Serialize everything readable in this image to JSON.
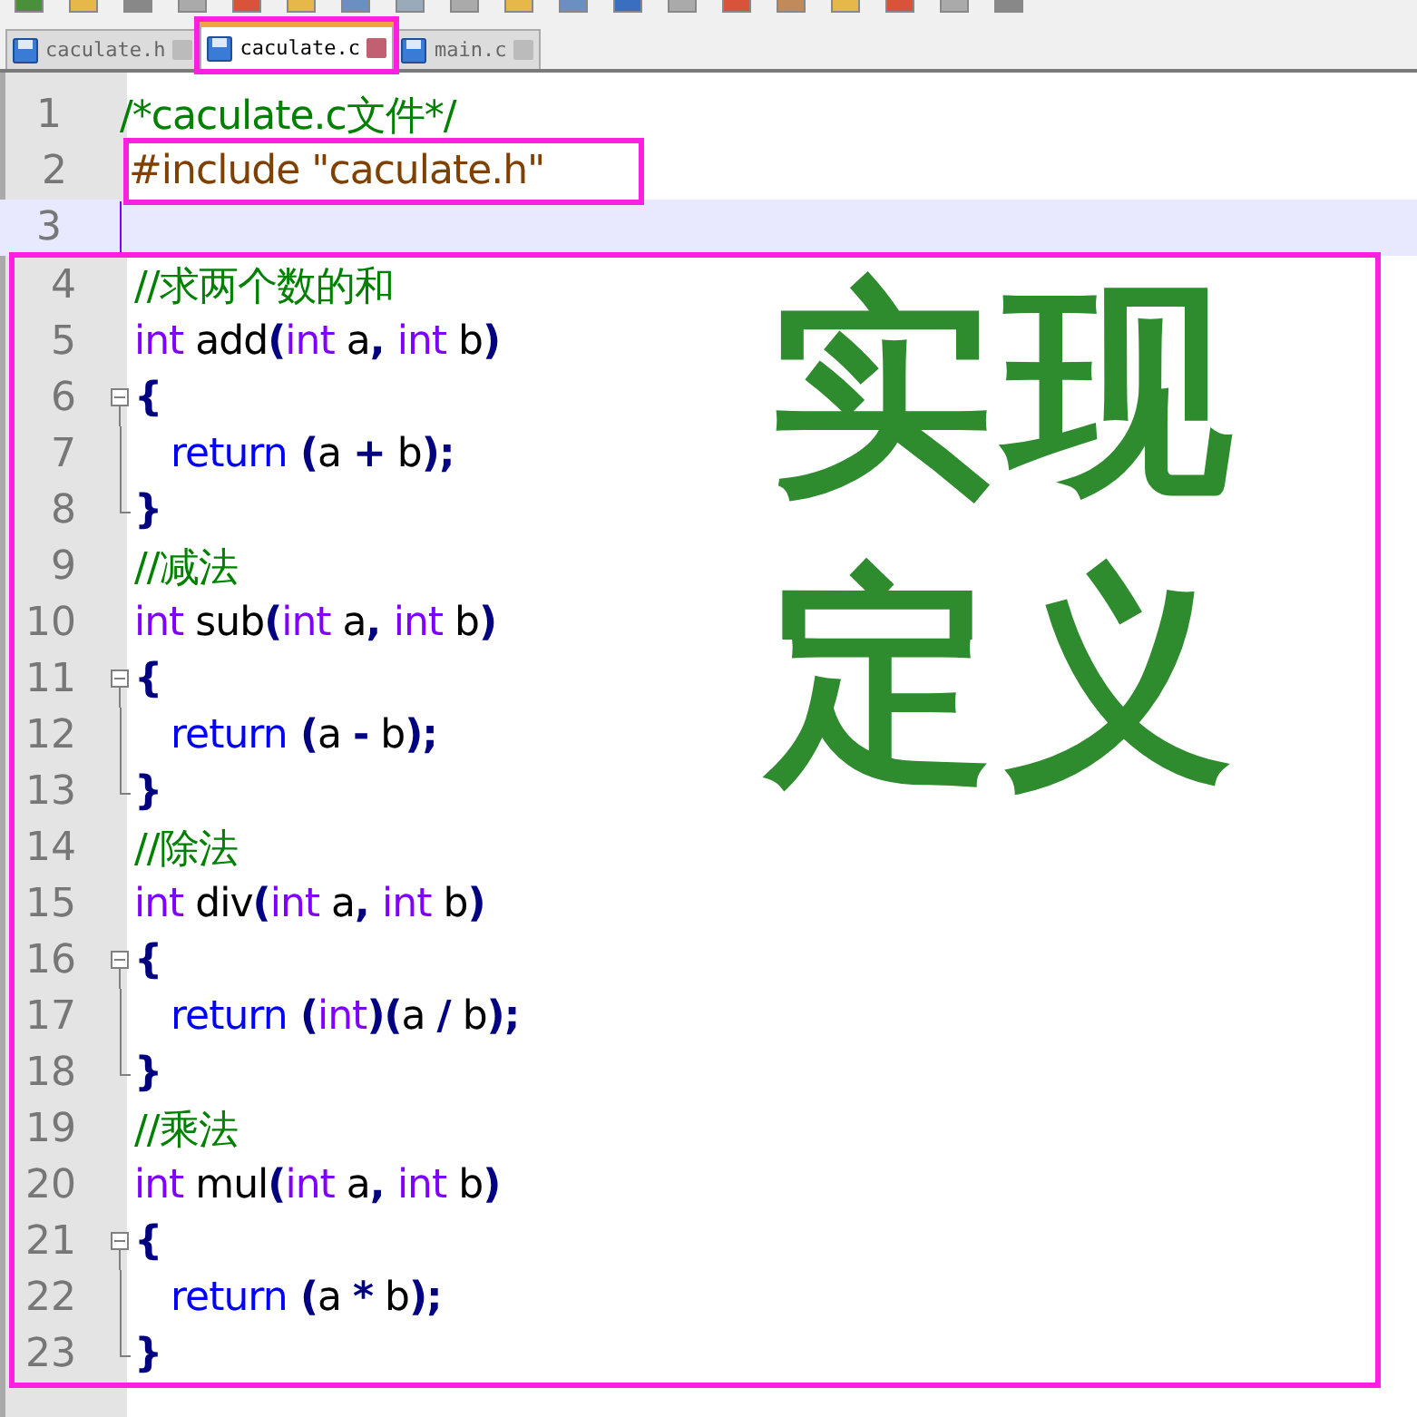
{
  "tabs": [
    {
      "label": "caculate.h",
      "selected": false,
      "outlined": false
    },
    {
      "label": "caculate.c",
      "selected": true,
      "outlined": true
    },
    {
      "label": "main.c",
      "selected": false,
      "outlined": false
    }
  ],
  "blocks": [
    {
      "kind": "plain",
      "lines": [
        {
          "number": "1",
          "kind": "plain",
          "current": false,
          "indent": false,
          "tokens": [
            {
              "kind": "comment",
              "text": "/*caculate.c文件*/"
            }
          ]
        }
      ]
    },
    {
      "kind": "code",
      "lines": [
        {
          "number": "2",
          "kind": "plain",
          "current": false,
          "indent": false,
          "tokens": [
            {
              "kind": "preproc",
              "text": "#include \"caculate.h\""
            }
          ]
        }
      ]
    },
    {
      "kind": "plain",
      "lines": [
        {
          "number": "3",
          "kind": "plain",
          "current": true
        }
      ]
    },
    {
      "kind": "full",
      "annotation": [
        "实现",
        "定义"
      ],
      "lines": [
        {
          "number": "4",
          "kind": "plain",
          "current": false,
          "indent": false,
          "tokens": [
            {
              "kind": "comment",
              "text": "//求两个数的和"
            }
          ]
        },
        {
          "number": "5",
          "kind": "plain",
          "current": false,
          "indent": false,
          "tokens": [
            {
              "kind": "type",
              "text": "int"
            },
            {
              "kind": "plain",
              "text": " add"
            },
            {
              "kind": "op",
              "text": "("
            },
            {
              "kind": "type",
              "text": "int"
            },
            {
              "kind": "plain",
              "text": " a"
            },
            {
              "kind": "op",
              "text": ", "
            },
            {
              "kind": "type",
              "text": "int"
            },
            {
              "kind": "plain",
              "text": " b"
            },
            {
              "kind": "op",
              "text": ")"
            }
          ]
        },
        {
          "number": "6",
          "kind": "open",
          "current": false,
          "indent": false,
          "tokens": [
            {
              "kind": "op",
              "text": "{"
            }
          ]
        },
        {
          "number": "7",
          "kind": "inner",
          "current": false,
          "indent": true,
          "tokens": [
            {
              "kind": "keyword",
              "text": "return"
            },
            {
              "kind": "op",
              "text": " ("
            },
            {
              "kind": "plain",
              "text": "a "
            },
            {
              "kind": "op",
              "text": "+"
            },
            {
              "kind": "plain",
              "text": " b"
            },
            {
              "kind": "op",
              "text": ");"
            }
          ]
        },
        {
          "number": "8",
          "kind": "close",
          "current": false,
          "indent": false,
          "tokens": [
            {
              "kind": "op",
              "text": "}"
            }
          ]
        },
        {
          "number": "9",
          "kind": "plain",
          "current": false,
          "indent": false,
          "tokens": [
            {
              "kind": "comment",
              "text": "//减法"
            }
          ]
        },
        {
          "number": "10",
          "kind": "plain",
          "current": false,
          "indent": false,
          "tokens": [
            {
              "kind": "type",
              "text": "int"
            },
            {
              "kind": "plain",
              "text": " sub"
            },
            {
              "kind": "op",
              "text": "("
            },
            {
              "kind": "type",
              "text": "int"
            },
            {
              "kind": "plain",
              "text": " a"
            },
            {
              "kind": "op",
              "text": ", "
            },
            {
              "kind": "type",
              "text": "int"
            },
            {
              "kind": "plain",
              "text": " b"
            },
            {
              "kind": "op",
              "text": ")"
            }
          ]
        },
        {
          "number": "11",
          "kind": "open",
          "current": false,
          "indent": false,
          "tokens": [
            {
              "kind": "op",
              "text": "{"
            }
          ]
        },
        {
          "number": "12",
          "kind": "inner",
          "current": false,
          "indent": true,
          "tokens": [
            {
              "kind": "keyword",
              "text": "return"
            },
            {
              "kind": "op",
              "text": " ("
            },
            {
              "kind": "plain",
              "text": "a "
            },
            {
              "kind": "op",
              "text": "-"
            },
            {
              "kind": "plain",
              "text": " b"
            },
            {
              "kind": "op",
              "text": ");"
            }
          ]
        },
        {
          "number": "13",
          "kind": "close",
          "current": false,
          "indent": false,
          "tokens": [
            {
              "kind": "op",
              "text": "}"
            }
          ]
        },
        {
          "number": "14",
          "kind": "plain",
          "current": false,
          "indent": false,
          "tokens": [
            {
              "kind": "comment",
              "text": "//除法"
            }
          ]
        },
        {
          "number": "15",
          "kind": "plain",
          "current": false,
          "indent": false,
          "tokens": [
            {
              "kind": "type",
              "text": "int"
            },
            {
              "kind": "plain",
              "text": " div"
            },
            {
              "kind": "op",
              "text": "("
            },
            {
              "kind": "type",
              "text": "int"
            },
            {
              "kind": "plain",
              "text": " a"
            },
            {
              "kind": "op",
              "text": ", "
            },
            {
              "kind": "type",
              "text": "int"
            },
            {
              "kind": "plain",
              "text": " b"
            },
            {
              "kind": "op",
              "text": ")"
            }
          ]
        },
        {
          "number": "16",
          "kind": "open",
          "current": false,
          "indent": false,
          "tokens": [
            {
              "kind": "op",
              "text": "{"
            }
          ]
        },
        {
          "number": "17",
          "kind": "inner",
          "current": false,
          "indent": true,
          "tokens": [
            {
              "kind": "keyword",
              "text": "return"
            },
            {
              "kind": "op",
              "text": " ("
            },
            {
              "kind": "type",
              "text": "int"
            },
            {
              "kind": "op",
              "text": ")("
            },
            {
              "kind": "plain",
              "text": "a "
            },
            {
              "kind": "op",
              "text": "/"
            },
            {
              "kind": "plain",
              "text": " b"
            },
            {
              "kind": "op",
              "text": ");"
            }
          ]
        },
        {
          "number": "18",
          "kind": "close",
          "current": false,
          "indent": false,
          "tokens": [
            {
              "kind": "op",
              "text": "}"
            }
          ]
        },
        {
          "number": "19",
          "kind": "plain",
          "current": false,
          "indent": false,
          "tokens": [
            {
              "kind": "comment",
              "text": "//乘法"
            }
          ]
        },
        {
          "number": "20",
          "kind": "plain",
          "current": false,
          "indent": false,
          "tokens": [
            {
              "kind": "type",
              "text": "int"
            },
            {
              "kind": "plain",
              "text": " mul"
            },
            {
              "kind": "op",
              "text": "("
            },
            {
              "kind": "type",
              "text": "int"
            },
            {
              "kind": "plain",
              "text": " a"
            },
            {
              "kind": "op",
              "text": ", "
            },
            {
              "kind": "type",
              "text": "int"
            },
            {
              "kind": "plain",
              "text": " b"
            },
            {
              "kind": "op",
              "text": ")"
            }
          ]
        },
        {
          "number": "21",
          "kind": "open",
          "current": false,
          "indent": false,
          "tokens": [
            {
              "kind": "op",
              "text": "{"
            }
          ]
        },
        {
          "number": "22",
          "kind": "inner",
          "current": false,
          "indent": true,
          "tokens": [
            {
              "kind": "keyword",
              "text": "return"
            },
            {
              "kind": "op",
              "text": " ("
            },
            {
              "kind": "plain",
              "text": "a "
            },
            {
              "kind": "op",
              "text": "*"
            },
            {
              "kind": "plain",
              "text": " b"
            },
            {
              "kind": "op",
              "text": ");"
            }
          ]
        },
        {
          "number": "23",
          "kind": "close",
          "current": false,
          "indent": false,
          "tokens": [
            {
              "kind": "op",
              "text": "}"
            }
          ]
        }
      ]
    }
  ]
}
